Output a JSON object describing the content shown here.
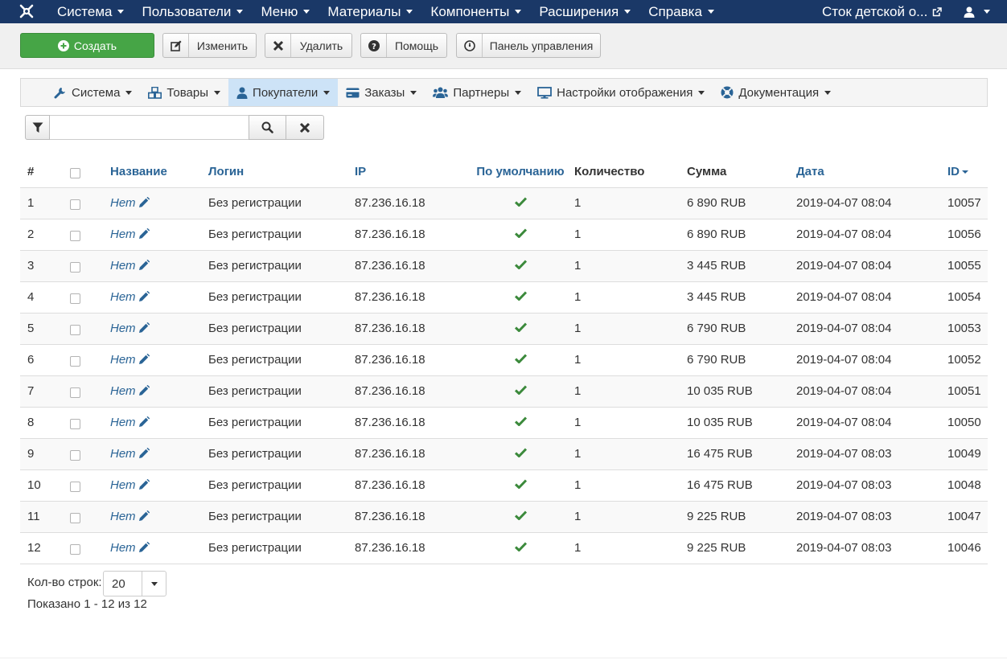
{
  "navbar": {
    "menu": [
      {
        "label": "Система"
      },
      {
        "label": "Пользователи"
      },
      {
        "label": "Меню"
      },
      {
        "label": "Материалы"
      },
      {
        "label": "Компоненты"
      },
      {
        "label": "Расширения"
      },
      {
        "label": "Справка"
      }
    ],
    "site_link": "Сток детской о...",
    "bg_color": "#1a3867"
  },
  "toolbar": {
    "create": "Создать",
    "edit": "Изменить",
    "delete": "Удалить",
    "help": "Помощь",
    "panel": "Панель управления",
    "create_color": "#46a546"
  },
  "subnav": {
    "items": [
      {
        "label": "Система",
        "icon": "wrench-icon"
      },
      {
        "label": "Товары",
        "icon": "cubes-icon"
      },
      {
        "label": "Покупатели",
        "icon": "user-icon",
        "active": true
      },
      {
        "label": "Заказы",
        "icon": "credit-card-icon"
      },
      {
        "label": "Партнеры",
        "icon": "users-icon"
      },
      {
        "label": "Настройки отображения",
        "icon": "monitor-icon"
      },
      {
        "label": "Документация",
        "icon": "lifebuoy-icon"
      }
    ]
  },
  "filter": {
    "value": ""
  },
  "table": {
    "headers": {
      "num": "#",
      "name": "Название",
      "login": "Логин",
      "ip": "IP",
      "default": "По умолчанию",
      "qty": "Количество",
      "sum": "Сумма",
      "date": "Дата",
      "id": "ID"
    },
    "rows": [
      {
        "num": "1",
        "name": "Нет",
        "login": "Без регистрации",
        "ip": "87.236.16.18",
        "qty": "1",
        "sum": "6 890 RUB",
        "date": "2019-04-07 08:04",
        "id": "10057"
      },
      {
        "num": "2",
        "name": "Нет",
        "login": "Без регистрации",
        "ip": "87.236.16.18",
        "qty": "1",
        "sum": "6 890 RUB",
        "date": "2019-04-07 08:04",
        "id": "10056"
      },
      {
        "num": "3",
        "name": "Нет",
        "login": "Без регистрации",
        "ip": "87.236.16.18",
        "qty": "1",
        "sum": "3 445 RUB",
        "date": "2019-04-07 08:04",
        "id": "10055"
      },
      {
        "num": "4",
        "name": "Нет",
        "login": "Без регистрации",
        "ip": "87.236.16.18",
        "qty": "1",
        "sum": "3 445 RUB",
        "date": "2019-04-07 08:04",
        "id": "10054"
      },
      {
        "num": "5",
        "name": "Нет",
        "login": "Без регистрации",
        "ip": "87.236.16.18",
        "qty": "1",
        "sum": "6 790 RUB",
        "date": "2019-04-07 08:04",
        "id": "10053"
      },
      {
        "num": "6",
        "name": "Нет",
        "login": "Без регистрации",
        "ip": "87.236.16.18",
        "qty": "1",
        "sum": "6 790 RUB",
        "date": "2019-04-07 08:04",
        "id": "10052"
      },
      {
        "num": "7",
        "name": "Нет",
        "login": "Без регистрации",
        "ip": "87.236.16.18",
        "qty": "1",
        "sum": "10 035 RUB",
        "date": "2019-04-07 08:04",
        "id": "10051"
      },
      {
        "num": "8",
        "name": "Нет",
        "login": "Без регистрации",
        "ip": "87.236.16.18",
        "qty": "1",
        "sum": "10 035 RUB",
        "date": "2019-04-07 08:04",
        "id": "10050"
      },
      {
        "num": "9",
        "name": "Нет",
        "login": "Без регистрации",
        "ip": "87.236.16.18",
        "qty": "1",
        "sum": "16 475 RUB",
        "date": "2019-04-07 08:03",
        "id": "10049"
      },
      {
        "num": "10",
        "name": "Нет",
        "login": "Без регистрации",
        "ip": "87.236.16.18",
        "qty": "1",
        "sum": "16 475 RUB",
        "date": "2019-04-07 08:03",
        "id": "10048"
      },
      {
        "num": "11",
        "name": "Нет",
        "login": "Без регистрации",
        "ip": "87.236.16.18",
        "qty": "1",
        "sum": "9 225 RUB",
        "date": "2019-04-07 08:03",
        "id": "10047"
      },
      {
        "num": "12",
        "name": "Нет",
        "login": "Без регистрации",
        "ip": "87.236.16.18",
        "qty": "1",
        "sum": "9 225 RUB",
        "date": "2019-04-07 08:03",
        "id": "10046"
      }
    ],
    "default_check_color": "#3c8a3c",
    "link_color": "#2a6496"
  },
  "footer": {
    "rows_label": "Кол-во строк:",
    "rows_value": "20",
    "shown": "Показано 1 - 12 из 12"
  }
}
